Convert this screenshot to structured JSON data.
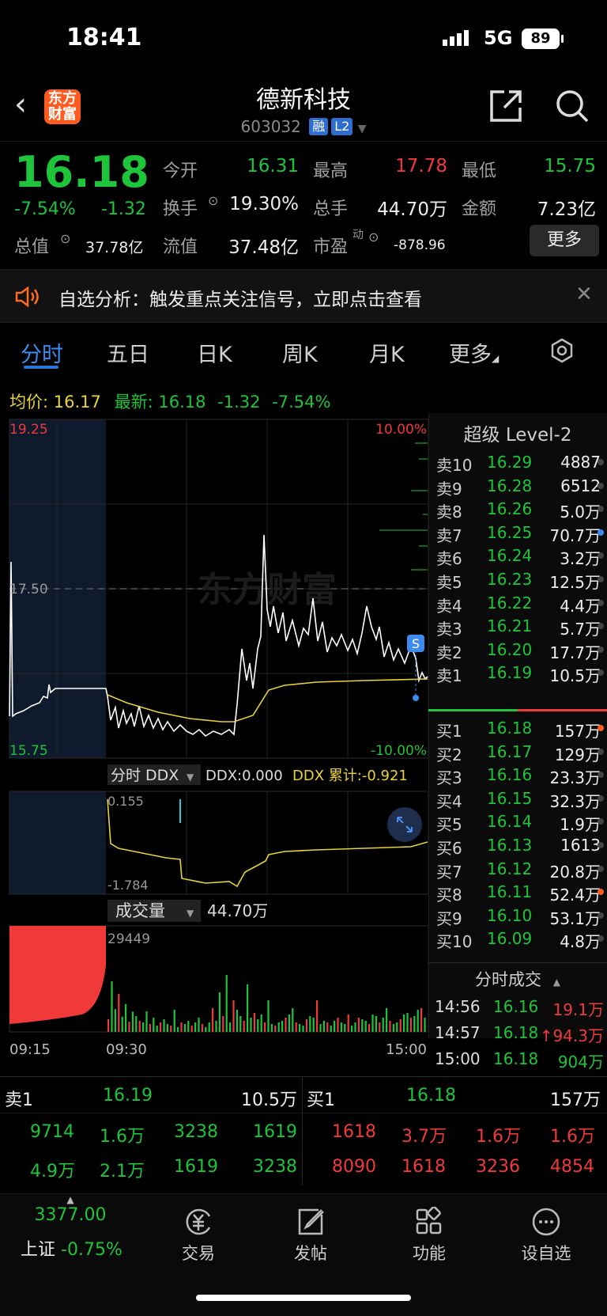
{
  "status": {
    "time": "18:41",
    "network": "5G",
    "battery": "89"
  },
  "header": {
    "logo": "东方财富",
    "title": "德新科技",
    "code": "603032",
    "badge_rong": "融",
    "badge_l2": "L2"
  },
  "quote": {
    "price": "16.18",
    "pct": "-7.54%",
    "change": "-1.32",
    "open_label": "今开",
    "open": "16.31",
    "high_label": "最高",
    "high": "17.78",
    "low_label": "最低",
    "low": "15.75",
    "turnover_label": "换手",
    "turnover": "19.30%",
    "volume_label": "总手",
    "volume": "44.70万",
    "amount_label": "金额",
    "amount": "7.23亿",
    "mktcap_label": "总值",
    "mktcap": "37.78亿",
    "float_label": "流值",
    "float": "37.48亿",
    "pe_label": "市盈",
    "pe_sup": "动",
    "pe": "-878.96",
    "more": "更多"
  },
  "notice": {
    "text": "自选分析：触发重点关注信号，立即点击查看"
  },
  "tabs": [
    "分时",
    "五日",
    "日K",
    "周K",
    "月K",
    "更多"
  ],
  "info_line": {
    "avg_label": "均价:",
    "avg": "16.17",
    "latest_label": "最新:",
    "latest": "16.18",
    "chg": "-1.32",
    "pct": "-7.54%"
  },
  "chart": {
    "top_price": "19.25",
    "mid_price": "17.50",
    "bottom_price": "15.75",
    "top_pct": "10.00%",
    "bottom_pct": "-10.00%",
    "watermark": "东方财富",
    "ddx_tab": "分时 DDX",
    "ddx_value": "DDX:0.000",
    "ddx_cum": "DDX 累计:-0.921",
    "ddx_high": "0.155",
    "ddx_low": "-1.784",
    "vol_tab": "成交量",
    "vol_total": "44.70万",
    "vol_max": "29449",
    "t_start": "09:15",
    "t_open": "09:30",
    "t_end": "15:00",
    "s_marker": "S"
  },
  "orderbook": {
    "title": "超级 Level-2",
    "asks": [
      {
        "label": "卖10",
        "price": "16.29",
        "vol": "4887"
      },
      {
        "label": "卖9",
        "price": "16.28",
        "vol": "6512"
      },
      {
        "label": "卖8",
        "price": "16.26",
        "vol": "5.0万"
      },
      {
        "label": "卖7",
        "price": "16.25",
        "vol": "70.7万"
      },
      {
        "label": "卖6",
        "price": "16.24",
        "vol": "3.2万"
      },
      {
        "label": "卖5",
        "price": "16.23",
        "vol": "12.5万"
      },
      {
        "label": "卖4",
        "price": "16.22",
        "vol": "4.4万"
      },
      {
        "label": "卖3",
        "price": "16.21",
        "vol": "5.7万"
      },
      {
        "label": "卖2",
        "price": "16.20",
        "vol": "17.7万"
      },
      {
        "label": "卖1",
        "price": "16.19",
        "vol": "10.5万"
      }
    ],
    "bids": [
      {
        "label": "买1",
        "price": "16.18",
        "vol": "157万"
      },
      {
        "label": "买2",
        "price": "16.17",
        "vol": "129万"
      },
      {
        "label": "买3",
        "price": "16.16",
        "vol": "23.3万"
      },
      {
        "label": "买4",
        "price": "16.15",
        "vol": "32.3万"
      },
      {
        "label": "买5",
        "price": "16.14",
        "vol": "1.9万"
      },
      {
        "label": "买6",
        "price": "16.13",
        "vol": "1613"
      },
      {
        "label": "买7",
        "price": "16.12",
        "vol": "20.8万"
      },
      {
        "label": "买8",
        "price": "16.11",
        "vol": "52.4万"
      },
      {
        "label": "买9",
        "price": "16.10",
        "vol": "53.1万"
      },
      {
        "label": "买10",
        "price": "16.09",
        "vol": "4.8万"
      }
    ],
    "trades_title": "分时成交",
    "trades": [
      {
        "time": "14:56",
        "price": "16.16",
        "vol": "19.1万"
      },
      {
        "time": "14:57",
        "price": "16.18",
        "vol": "↑94.3万"
      },
      {
        "time": "15:00",
        "price": "16.18",
        "vol": "904万"
      }
    ]
  },
  "bottom_book": {
    "sell_label": "卖1",
    "sell_price": "16.19",
    "sell_vol": "10.5万",
    "buy_label": "买1",
    "buy_price": "16.18",
    "buy_vol": "157万",
    "sell_row1": [
      "9714",
      "1.6万",
      "3238",
      "1619"
    ],
    "sell_row2": [
      "4.9万",
      "2.1万",
      "1619",
      "3238"
    ],
    "buy_row1": [
      "1618",
      "3.7万",
      "1.6万",
      "1.6万"
    ],
    "buy_row2": [
      "8090",
      "1618",
      "3236",
      "4854"
    ]
  },
  "nav": {
    "index_value": "3377.00",
    "index_name": "上证",
    "index_pct": "-0.75%",
    "trade": "交易",
    "post": "发帖",
    "func": "功能",
    "watch": "设自选"
  }
}
